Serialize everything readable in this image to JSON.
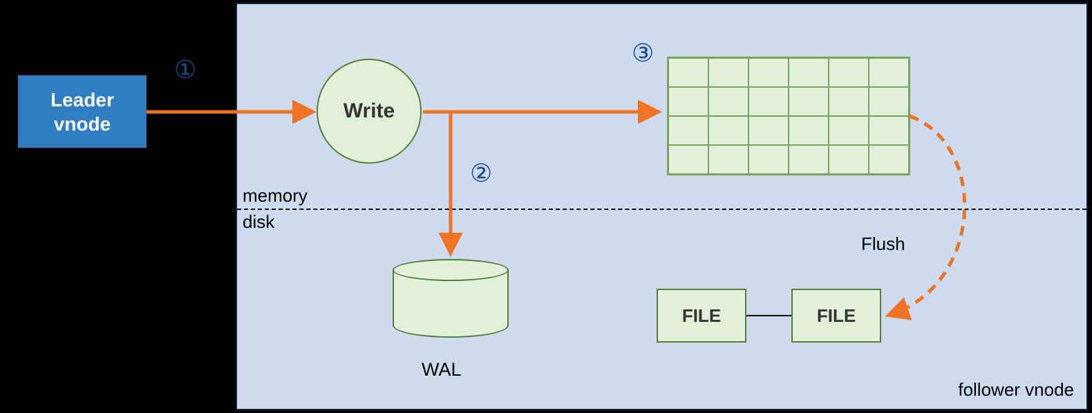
{
  "leader": {
    "line1": "Leader",
    "line2": "vnode"
  },
  "container": {
    "memory_label": "memory",
    "disk_label": "disk",
    "follower_label": "follower vnode"
  },
  "write": {
    "label": "Write"
  },
  "wal": {
    "label": "WAL"
  },
  "file1": {
    "label": "FILE"
  },
  "file2": {
    "label": "FILE"
  },
  "flush": {
    "label": "Flush"
  },
  "steps": {
    "s1": "①",
    "s2": "②",
    "s3": "③"
  },
  "colors": {
    "arrow": "#ee7322",
    "dashed_arrow": "#ee7322",
    "fill": "#e2efd9",
    "border": "#527f35",
    "container_bg": "#cedbee",
    "leader_bg": "#307cc3",
    "step_color": "#134b87"
  },
  "grid": {
    "rows": 4,
    "cols": 6
  }
}
